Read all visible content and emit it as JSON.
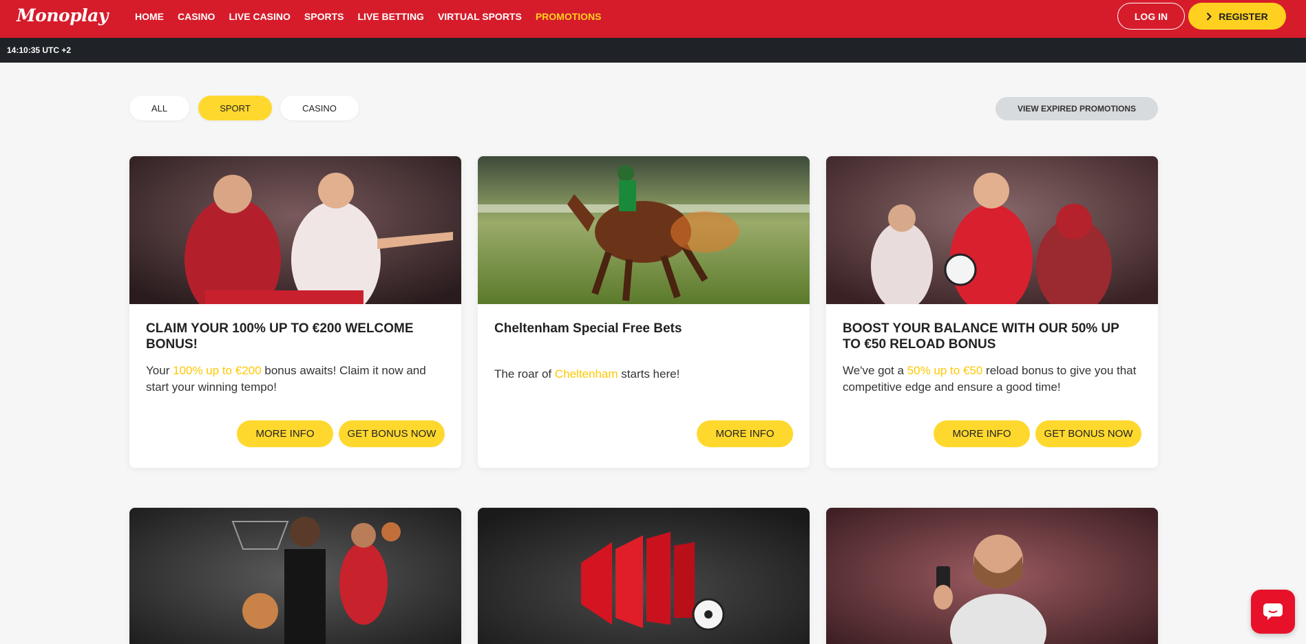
{
  "header": {
    "logo": "Monoplay",
    "nav": [
      "HOME",
      "CASINO",
      "LIVE CASINO",
      "SPORTS",
      "LIVE BETTING",
      "VIRTUAL SPORTS",
      "PROMOTIONS"
    ],
    "active_nav": "PROMOTIONS",
    "login_label": "LOG IN",
    "register_label": "REGISTER"
  },
  "time_bar": {
    "time": "14:10:35 UTC +2"
  },
  "filters": {
    "items": [
      "ALL",
      "SPORT",
      "CASINO"
    ],
    "selected": "SPORT",
    "expired_label": "VIEW EXPIRED PROMOTIONS"
  },
  "promotions": [
    {
      "title": "CLAIM YOUR 100% UP TO €200 WELCOME BONUS!",
      "desc_before": "Your ",
      "desc_highlight": "100% up to €200",
      "desc_after": " bonus awaits! Claim it now and start your winning tempo!",
      "more_info_label": "MORE INFO",
      "bonus_label": "GET BONUS NOW"
    },
    {
      "title": "Cheltenham Special Free Bets",
      "desc_before": "The roar of ",
      "desc_highlight": "Cheltenham",
      "desc_after": " starts here!",
      "more_info_label": "MORE INFO"
    },
    {
      "title": "BOOST YOUR BALANCE WITH OUR 50% UP TO €50 RELOAD BONUS",
      "desc_before": "We've got a ",
      "desc_highlight": "50% up to €50",
      "desc_after": " reload bonus to give you that competitive edge and ensure a good time!",
      "more_info_label": "MORE INFO",
      "bonus_label": "GET BONUS NOW"
    }
  ],
  "colors": {
    "brand_red": "#d61c2b",
    "accent_yellow": "#ffd01f",
    "highlight_text": "#ffc800",
    "time_bar_bg": "#1f2226"
  },
  "icons": [
    "chevron-right-icon",
    "chat-icon"
  ]
}
